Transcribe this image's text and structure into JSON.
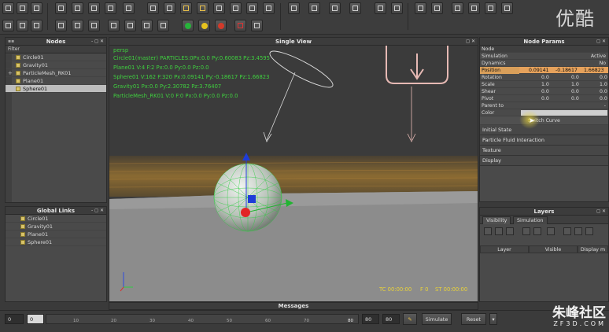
{
  "watermark_top": "优酷",
  "watermark_bottom": {
    "brand": "朱峰社区",
    "domain": "ZF3D.COM"
  },
  "nodes_panel": {
    "title": "Nodes",
    "filter_label": "Filter",
    "items": [
      {
        "label": "Circle01"
      },
      {
        "label": "Gravity01"
      },
      {
        "label": "ParticleMesh_RK01",
        "expand": "+"
      },
      {
        "label": "Plane01"
      },
      {
        "label": "Sphere01",
        "selected": true
      }
    ]
  },
  "links_panel": {
    "title": "Global Links",
    "items": [
      "Circle01",
      "Gravity01",
      "Plane01",
      "Sphere01"
    ]
  },
  "viewport": {
    "title": "Single View",
    "camera": "persp",
    "info_lines": [
      "Circle01(master) PARTICLES:0Px:0.0 Py:0.60083 Pz:3.4595",
      "Plane01 V:4 F:2 Px:0.0 Py:0.0 Pz:0.0",
      "Sphere01 V:162 F:320 Px:0.09141 Py:-0.18617 Pz:1.66823",
      "Gravity01 Px:0.0 Py:2.30782 Pz:3.76407",
      "ParticleMesh_RK01 V:0 F:0 Px:0.0 Py:0.0 Pz:0.0"
    ],
    "tc": "TC 00:00:00",
    "frame": "F 0",
    "st": "ST 00:00:00"
  },
  "params_panel": {
    "title": "Node Params",
    "section": "Node",
    "simulation": {
      "label": "Simulation",
      "value": "Active"
    },
    "dynamics": {
      "label": "Dynamics",
      "value": "No"
    },
    "position": {
      "label": "Position",
      "x": "0.09141",
      "y": "-0.18617",
      "z": "1.66823"
    },
    "rotation": {
      "label": "Rotation",
      "x": "0.0",
      "y": "0.0",
      "z": "0.0"
    },
    "scale": {
      "label": "Scale",
      "x": "1.0",
      "y": "1.0",
      "z": "1.0"
    },
    "shear": {
      "label": "Shear",
      "x": "0.0",
      "y": "0.0",
      "z": "0.0"
    },
    "pivot": {
      "label": "Pivot",
      "x": "0.0",
      "y": "0.0",
      "z": "0.0"
    },
    "parent_to": {
      "label": "Parent to",
      "value": "-"
    },
    "color": {
      "label": "Color",
      "swatch": "#cfcfcf"
    },
    "curve_button": "Switch Curve",
    "sections": [
      "Initial State",
      "Particle Fluid Interaction",
      "Texture",
      "Display"
    ]
  },
  "layers_panel": {
    "title": "Layers",
    "tabs": [
      "Visibility",
      "Simulation"
    ],
    "columns": [
      "Layer",
      "Visible",
      "Display m"
    ]
  },
  "messages": {
    "title": "Messages"
  },
  "timeline": {
    "start": "0",
    "current": "0",
    "ticks": [
      "10",
      "20",
      "30",
      "40",
      "50",
      "60",
      "70",
      "80"
    ],
    "end_field": "80",
    "range_a": "80",
    "range_b": "80",
    "simulate": "Simulate",
    "reset": "Reset"
  },
  "colors": {
    "accent_highlight": "#e6a25c",
    "viewport_text": "#3fcf3f",
    "sphere_wire": "#2ecc40"
  }
}
